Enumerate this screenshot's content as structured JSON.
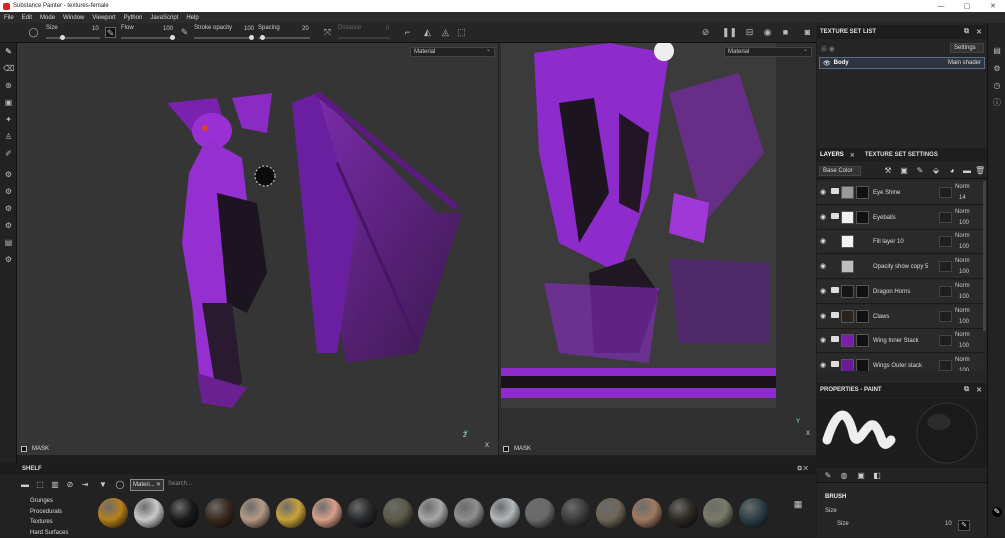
{
  "window": {
    "title": "Substance Painter - textures-female",
    "controls": [
      "—",
      "▢",
      "✕"
    ]
  },
  "menu": [
    "File",
    "Edit",
    "Mode",
    "Window",
    "Viewport",
    "Python",
    "JavaScript",
    "Help"
  ],
  "tool_options": {
    "size_label": "Size",
    "size_value": "10",
    "flow_label": "Flow",
    "flow_value": "100",
    "stroke_opacity_label": "Stroke opacity",
    "stroke_opacity_value": "100",
    "spacing_label": "Spacing",
    "spacing_value": "20",
    "distance_label": "Distance",
    "distance_value": "0"
  },
  "viewports": {
    "left_material": "Material",
    "right_material": "Material",
    "mask_label": "MASK",
    "axis": {
      "x": "X",
      "y": "Y",
      "z": "Z"
    }
  },
  "texture_set_list": {
    "title": "TEXTURE SET LIST",
    "settings_label": "Settings",
    "item_name": "Body",
    "item_shader": "Main shader"
  },
  "layer_tabs": {
    "layers": "LAYERS",
    "texture_set_settings": "TEXTURE SET SETTINGS"
  },
  "channel_select": "Base Color",
  "layers": [
    {
      "name": "Eye Shine",
      "blend": "Norm",
      "opacity": "14",
      "folder": true,
      "th1": "#9a9a9a",
      "th2": "#111"
    },
    {
      "name": "Eyeballs",
      "blend": "Norm",
      "opacity": "100",
      "folder": true,
      "th1": "#f2f2f2",
      "th2": "#111"
    },
    {
      "name": "Fill layer 10",
      "blend": "Norm",
      "opacity": "100",
      "folder": false,
      "th1": "#f5f5f5",
      "th2": ""
    },
    {
      "name": "Opacity show copy 5",
      "blend": "Norm",
      "opacity": "100",
      "folder": false,
      "th1": "#bdbdbd",
      "th2": ""
    },
    {
      "name": "Dragon Horns",
      "blend": "Norm",
      "opacity": "100",
      "folder": true,
      "th1": "#151515",
      "th2": "#111"
    },
    {
      "name": "Claws",
      "blend": "Norm",
      "opacity": "100",
      "folder": true,
      "th1": "#2a2418",
      "th2": "#111"
    },
    {
      "name": "Wing Inner Stack",
      "blend": "Norm",
      "opacity": "100",
      "folder": true,
      "th1": "#7a1fa8",
      "th2": "#111"
    },
    {
      "name": "Wings Outer stack",
      "blend": "Norm",
      "opacity": "100",
      "folder": true,
      "th1": "#6a1a92",
      "th2": "#111"
    }
  ],
  "properties": {
    "title": "PROPERTIES - PAINT",
    "brush_section": "BRUSH",
    "size_header": "Size",
    "size_label": "Size",
    "size_value": "10"
  },
  "shelf": {
    "title": "SHELF",
    "filter_chip": "Materi...",
    "search_placeholder": "Search...",
    "categories": [
      "Grunges",
      "Procedurals",
      "Textures",
      "Hard Surfaces"
    ],
    "material_colors": [
      "#b6801e",
      "#c9c9c9",
      "#1a1a1a",
      "#3a2a1e",
      "#b49a86",
      "#c8a23a",
      "#d9a08a",
      "#26282b",
      "#5c5a48",
      "#a8a8a8",
      "#8f8f8f",
      "#b3b8bb",
      "#6a6a6a",
      "#3c3c3c",
      "#6e6656",
      "#a07a62",
      "#2e2a24",
      "#7a7a6a",
      "#2c4048"
    ]
  },
  "colors": {
    "accent": "#7a1fa8",
    "purple": "#a336e0",
    "selection": "#5a6a8a"
  }
}
